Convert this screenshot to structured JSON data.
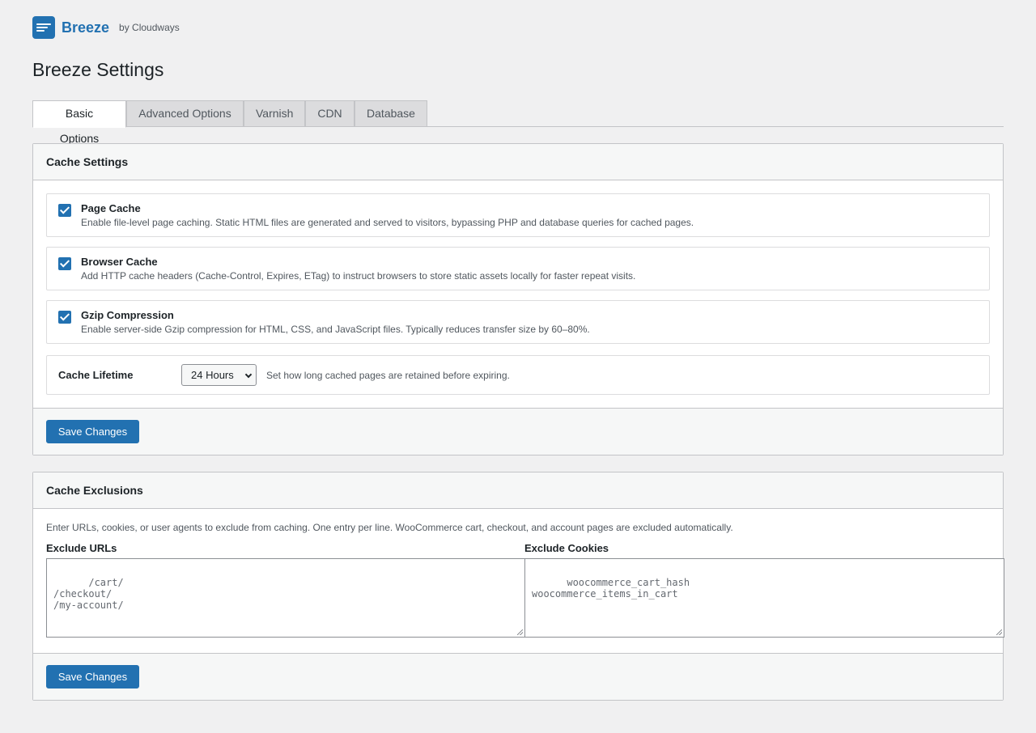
{
  "brand": {
    "name": "Breeze",
    "by": "by Cloudways",
    "logo_icon": "breeze-logo-icon"
  },
  "page": {
    "title": "Breeze Settings"
  },
  "tabs": [
    {
      "label": "Basic Options",
      "active": true
    },
    {
      "label": "Advanced Options",
      "active": false
    },
    {
      "label": "Varnish",
      "active": false
    },
    {
      "label": "CDN",
      "active": false
    },
    {
      "label": "Database",
      "active": false
    }
  ],
  "cache_settings": {
    "title": "Cache Settings",
    "options": [
      {
        "title": "Page Cache",
        "description": "Enable file-level page caching. Static HTML files are generated and served to visitors, bypassing PHP and database queries for cached pages.",
        "checked": true
      },
      {
        "title": "Browser Cache",
        "description": "Add HTTP cache headers (Cache-Control, Expires, ETag) to instruct browsers to store static assets locally for faster repeat visits.",
        "checked": true
      },
      {
        "title": "Gzip Compression",
        "description": "Enable server-side Gzip compression for HTML, CSS, and JavaScript files. Typically reduces transfer size by 60–80%.",
        "checked": true
      }
    ],
    "lifetime": {
      "label": "Cache Lifetime",
      "value": "24 Hours",
      "help": "Set how long cached pages are retained before expiring."
    },
    "save_label": "Save Changes"
  },
  "cache_exclusions": {
    "title": "Cache Exclusions",
    "intro": "Enter URLs, cookies, or user agents to exclude from caching. One entry per line. WooCommerce cart, checkout, and account pages are excluded automatically.",
    "urls_label": "Exclude URLs",
    "urls_value": "/cart/\n/checkout/\n/my-account/",
    "cookies_label": "Exclude Cookies",
    "cookies_value": "woocommerce_cart_hash\nwoocommerce_items_in_cart",
    "save_label": "Save Changes"
  },
  "colors": {
    "accent": "#2271b1",
    "background": "#f0f0f1"
  }
}
